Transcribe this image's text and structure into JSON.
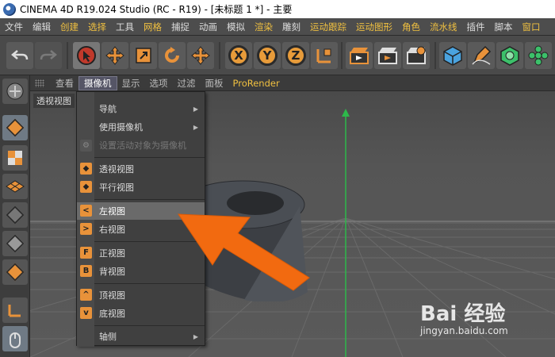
{
  "window": {
    "title": "CINEMA 4D R19.024 Studio (RC - R19) - [未标题 1 *] - 主要"
  },
  "menubar": {
    "items": [
      "文件",
      "编辑",
      "创建",
      "选择",
      "工具",
      "网格",
      "捕捉",
      "动画",
      "模拟",
      "渲染",
      "雕刻",
      "运动跟踪",
      "运动图形",
      "角色",
      "流水线",
      "插件",
      "脚本",
      "窗口"
    ]
  },
  "toolbar": {
    "axis_x": "X",
    "axis_y": "Y",
    "axis_z": "Z"
  },
  "viewport_header": {
    "menus": [
      "查看",
      "摄像机",
      "显示",
      "选项",
      "过滤",
      "面板",
      "ProRender"
    ]
  },
  "viewport": {
    "label": "透视视图"
  },
  "camera_menu": {
    "items": [
      {
        "label": "导航",
        "submenu": true
      },
      {
        "label": "使用摄像机",
        "submenu": true
      },
      {
        "label": "设置活动对象为摄像机",
        "disabled": true
      },
      {
        "label": "透视视图"
      },
      {
        "label": "平行视图"
      },
      {
        "label": "左视图",
        "icon": "<",
        "active": true
      },
      {
        "label": "右视图",
        "icon": ">"
      },
      {
        "label": "正视图",
        "icon": "F"
      },
      {
        "label": "背视图",
        "icon": "B"
      },
      {
        "label": "顶视图",
        "icon": "^"
      },
      {
        "label": "底视图",
        "icon": "v"
      },
      {
        "label": "轴侧",
        "submenu": true
      }
    ]
  },
  "watermark": {
    "logo": "Bai  经验",
    "url": "jingyan.baidu.com"
  },
  "colors": {
    "accent": "#e8923a",
    "arrow": "#f26a10",
    "axis_y": "#2db84a"
  }
}
